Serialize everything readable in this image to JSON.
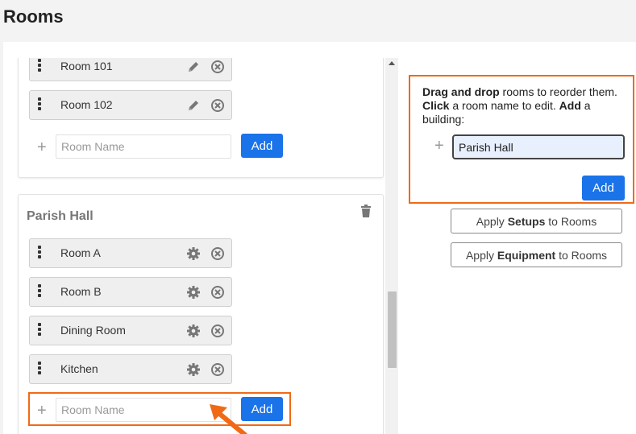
{
  "page": {
    "title": "Rooms"
  },
  "buildings": [
    {
      "name": "",
      "rooms": [
        {
          "name": "Room 101",
          "action_icon": "pencil-icon"
        },
        {
          "name": "Room 102",
          "action_icon": "pencil-icon"
        }
      ],
      "add_room": {
        "placeholder": "Room Name",
        "value": "",
        "button": "Add"
      }
    },
    {
      "name": "Parish Hall",
      "delete_icon": "trash-icon",
      "rooms": [
        {
          "name": "Room A",
          "action_icon": "gear-icon"
        },
        {
          "name": "Room B",
          "action_icon": "gear-icon"
        },
        {
          "name": "Dining Room",
          "action_icon": "gear-icon"
        },
        {
          "name": "Kitchen",
          "action_icon": "gear-icon"
        }
      ],
      "add_room": {
        "placeholder": "Room Name",
        "value": "",
        "button": "Add"
      }
    }
  ],
  "instructions": {
    "drag_bold": "Drag and drop",
    "drag_rest": " rooms to reorder them. ",
    "click_bold": "Click",
    "click_rest": " a room name to edit. ",
    "add_bold": "Add",
    "add_rest": " a building:"
  },
  "add_building": {
    "value": "Parish Hall",
    "button": "Add"
  },
  "apply_setups": {
    "prefix": "Apply ",
    "bold": "Setups",
    "suffix": " to Rooms"
  },
  "apply_equipment": {
    "prefix": "Apply ",
    "bold": "Equipment",
    "suffix": " to Rooms"
  },
  "colors": {
    "accent": "#1a73e8",
    "highlight": "#f06a16",
    "room_bg": "#efefef",
    "input_focus_bg": "#e8f0fe"
  }
}
